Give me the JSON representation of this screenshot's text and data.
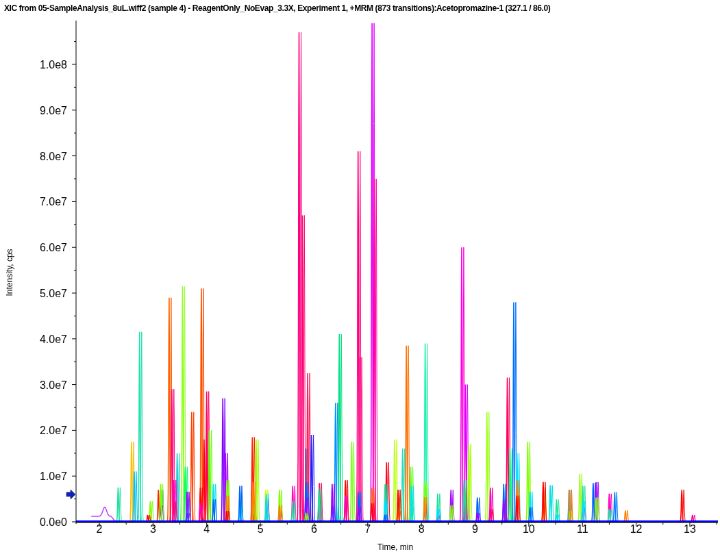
{
  "window": {
    "title": "XIC from 05-SampleAnalysis_8uL.wiff2 (sample 4) - ReagentOnly_NoEvap_3.3X, Experiment 1, +MRM (873 transitions):Acetopromazine-1 (327.1 / 86.0)"
  },
  "plot": {
    "ylabel": "Intensity, cps",
    "xlabel": "Time, min",
    "yticks": [
      "1.0e8",
      "9.0e7",
      "8.0e7",
      "7.0e7",
      "6.0e7",
      "5.0e7",
      "4.0e7",
      "3.0e7",
      "2.0e7",
      "1.0e7",
      "0.0e0"
    ],
    "xticks": [
      "2",
      "3",
      "4",
      "5",
      "6",
      "7",
      "8",
      "9",
      "10",
      "11",
      "12",
      "13"
    ]
  }
}
